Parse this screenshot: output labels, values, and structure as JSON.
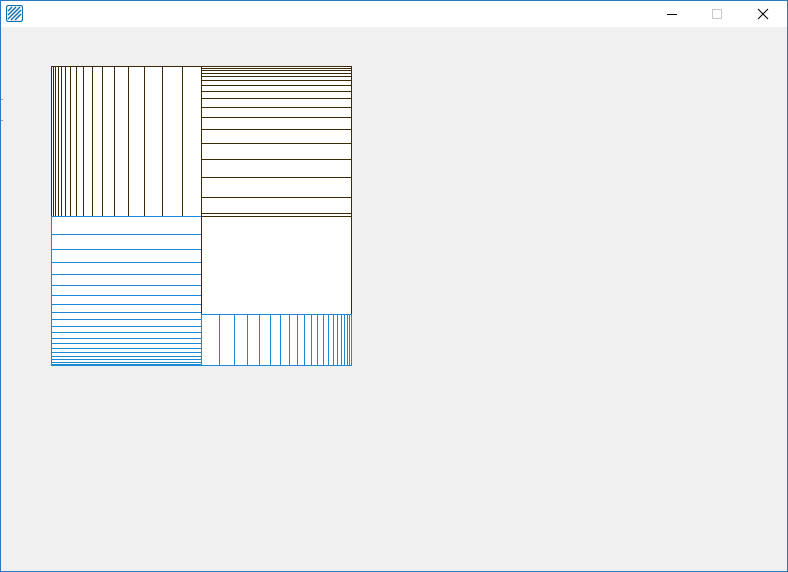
{
  "window": {
    "title": "",
    "icon": "hatched-pattern-icon",
    "controls": {
      "minimize_icon": "minimize-icon",
      "maximize_icon": "maximize-icon",
      "close_icon": "close-icon"
    }
  },
  "canvas": {
    "description_none": "",
    "colors": {
      "dark_lines": "#3a2a05",
      "blue_lines": "#1a8ad4",
      "fill": "#ffffff",
      "background": "#f0f0f0",
      "window_border": "#2b79c2"
    },
    "regions": [
      {
        "name": "top-left",
        "hatch": "vertical",
        "color": "dark",
        "density": "increasing-left"
      },
      {
        "name": "top-right",
        "hatch": "horizontal",
        "color": "dark",
        "density": "increasing-top"
      },
      {
        "name": "bottom-left",
        "hatch": "horizontal",
        "color": "blue",
        "density": "increasing-bottom"
      },
      {
        "name": "center",
        "hatch": "none",
        "color": "dark"
      },
      {
        "name": "bottom-right",
        "hatch": "vertical",
        "color": "blue",
        "density": "increasing-right"
      }
    ]
  }
}
